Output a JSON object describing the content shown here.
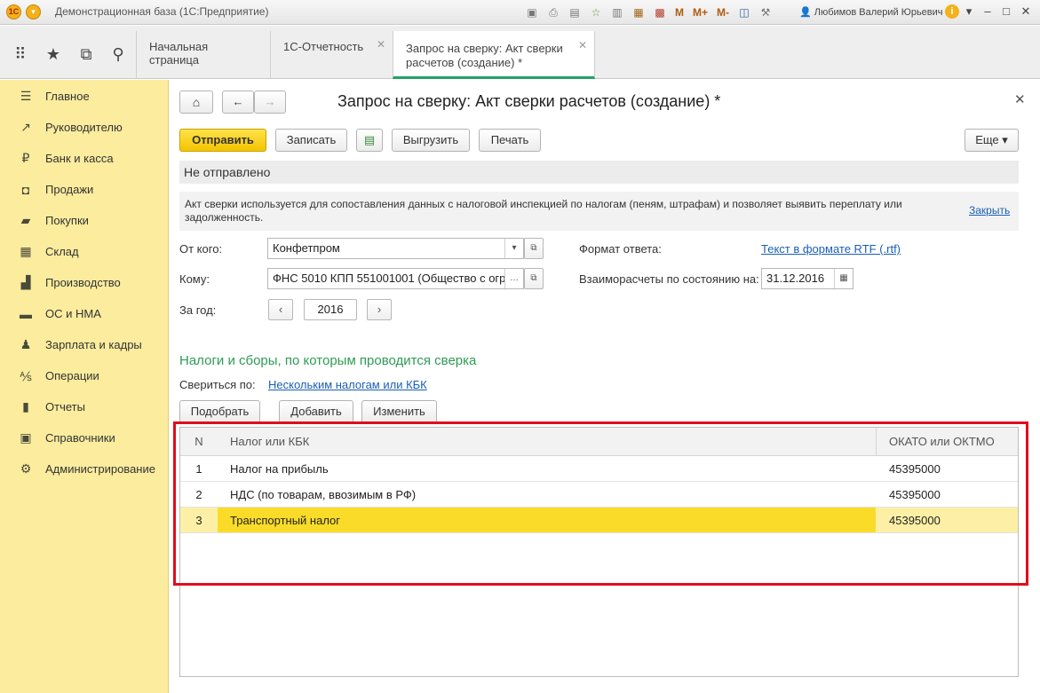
{
  "window": {
    "title": "Демонстрационная база (1С:Предприятие)",
    "user": "Любимов Валерий Юрьевич",
    "memory_buttons": [
      "M",
      "M+",
      "M-"
    ]
  },
  "tabs": [
    {
      "label": "Начальная страница"
    },
    {
      "label": "1С-Отчетность"
    },
    {
      "label_line1": "Запрос на сверку: Акт сверки",
      "label_line2": "расчетов (создание) *"
    }
  ],
  "sidebar": {
    "items": [
      {
        "label": "Главное",
        "icon": "menu-icon"
      },
      {
        "label": "Руководителю",
        "icon": "trend-icon"
      },
      {
        "label": "Банк и касса",
        "icon": "ruble-icon"
      },
      {
        "label": "Продажи",
        "icon": "bag-icon"
      },
      {
        "label": "Покупки",
        "icon": "cart-icon"
      },
      {
        "label": "Склад",
        "icon": "warehouse-icon"
      },
      {
        "label": "Производство",
        "icon": "factory-icon"
      },
      {
        "label": "ОС и НМА",
        "icon": "truck-icon"
      },
      {
        "label": "Зарплата и кадры",
        "icon": "people-icon"
      },
      {
        "label": "Операции",
        "icon": "operations-icon"
      },
      {
        "label": "Отчеты",
        "icon": "chart-icon"
      },
      {
        "label": "Справочники",
        "icon": "book-icon"
      },
      {
        "label": "Администрирование",
        "icon": "gear-icon"
      }
    ]
  },
  "document": {
    "title": "Запрос на сверку: Акт сверки расчетов (создание) *",
    "toolbar": {
      "send": "Отправить",
      "save": "Записать",
      "export": "Выгрузить",
      "print": "Печать",
      "more": "Еще"
    },
    "status": "Не отправлено",
    "info": "Акт сверки используется для сопоставления данных с налоговой инспекцией по налогам (пеням, штрафам) и позволяет выявить переплату или задолженность.",
    "info_close": "Закрыть",
    "from_label": "От кого:",
    "from_value": "Конфетпром",
    "to_label": "Кому:",
    "to_value": "ФНС 5010 КПП 551001001 (Общество с огр",
    "year_label": "За год:",
    "year_value": "2016",
    "format_label": "Формат ответа:",
    "format_value": "Текст в формате RTF (.rtf)",
    "date_label": "Взаиморасчеты по состоянию на:",
    "date_value": "31.12.2016",
    "section_title": "Налоги и сборы, по которым проводится сверка",
    "reconcile_label": "Свериться по:",
    "reconcile_value": "Нескольким налогам или КБК",
    "table_buttons": {
      "pick": "Подобрать",
      "add": "Добавить",
      "edit": "Изменить"
    },
    "table": {
      "columns": [
        "N",
        "Налог или КБК",
        "ОКАТО или ОКТМО"
      ],
      "rows": [
        {
          "n": "1",
          "tax": "Налог на прибыль",
          "okato": "45395000"
        },
        {
          "n": "2",
          "tax": "НДС (по товарам, ввозимым в РФ)",
          "okato": "45395000"
        },
        {
          "n": "3",
          "tax": "Транспортный налог",
          "okato": "45395000"
        }
      ],
      "selected_row": 3
    }
  },
  "colors": {
    "sidebar_bg": "#fbec9e",
    "primary_button": "#f3c300",
    "selected_row": "#fadc28",
    "link": "#1a5fb4",
    "section_title": "#2e9b55",
    "highlight_frame": "#e00d1c"
  }
}
